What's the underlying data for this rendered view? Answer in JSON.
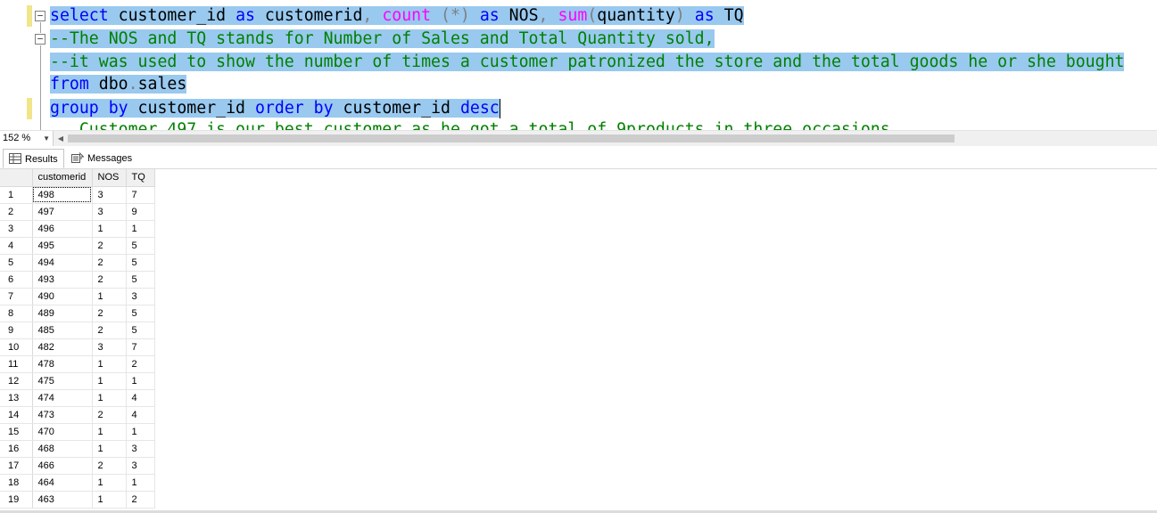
{
  "editor": {
    "lines": [
      {
        "tokens": [
          {
            "t": "select",
            "c": "kw"
          },
          {
            "t": " customer_id ",
            "c": ""
          },
          {
            "t": "as",
            "c": "kw"
          },
          {
            "t": " customerid",
            "c": ""
          },
          {
            "t": ", ",
            "c": "op"
          },
          {
            "t": "count",
            "c": "fn"
          },
          {
            "t": " (*) ",
            "c": "op"
          },
          {
            "t": "as",
            "c": "kw"
          },
          {
            "t": " NOS",
            "c": ""
          },
          {
            "t": ", ",
            "c": "op"
          },
          {
            "t": "sum",
            "c": "fn"
          },
          {
            "t": "(",
            "c": "op"
          },
          {
            "t": "quantity",
            "c": ""
          },
          {
            "t": ") ",
            "c": "op"
          },
          {
            "t": "as",
            "c": "kw"
          },
          {
            "t": " TQ",
            "c": ""
          }
        ]
      },
      {
        "tokens": [
          {
            "t": "--The NOS and TQ stands for Number of Sales and Total Quantity sold,",
            "c": "cm"
          }
        ]
      },
      {
        "tokens": [
          {
            "t": "--it was used to show the number of times a customer patronized the store and the total goods he or she bought",
            "c": "cm"
          }
        ]
      },
      {
        "tokens": [
          {
            "t": "from",
            "c": "kw"
          },
          {
            "t": " dbo",
            "c": ""
          },
          {
            "t": ".",
            "c": "op"
          },
          {
            "t": "sales",
            "c": ""
          }
        ]
      },
      {
        "tokens": [
          {
            "t": "group by",
            "c": "kw"
          },
          {
            "t": " customer_id ",
            "c": ""
          },
          {
            "t": "order by",
            "c": "kw"
          },
          {
            "t": " customer_id ",
            "c": ""
          },
          {
            "t": "desc",
            "c": "kw"
          }
        ]
      }
    ],
    "partial_line": "   Customer 497 is our best customer as he got a total of 9products in three occasions"
  },
  "zoom": {
    "value": "152 %"
  },
  "tabs": {
    "results": "Results",
    "messages": "Messages"
  },
  "grid": {
    "columns": [
      "customerid",
      "NOS",
      "TQ"
    ],
    "rows": [
      [
        "1",
        "498",
        "3",
        "7"
      ],
      [
        "2",
        "497",
        "3",
        "9"
      ],
      [
        "3",
        "496",
        "1",
        "1"
      ],
      [
        "4",
        "495",
        "2",
        "5"
      ],
      [
        "5",
        "494",
        "2",
        "5"
      ],
      [
        "6",
        "493",
        "2",
        "5"
      ],
      [
        "7",
        "490",
        "1",
        "3"
      ],
      [
        "8",
        "489",
        "2",
        "5"
      ],
      [
        "9",
        "485",
        "2",
        "5"
      ],
      [
        "10",
        "482",
        "3",
        "7"
      ],
      [
        "11",
        "478",
        "1",
        "2"
      ],
      [
        "12",
        "475",
        "1",
        "1"
      ],
      [
        "13",
        "474",
        "1",
        "4"
      ],
      [
        "14",
        "473",
        "2",
        "4"
      ],
      [
        "15",
        "470",
        "1",
        "1"
      ],
      [
        "16",
        "468",
        "1",
        "3"
      ],
      [
        "17",
        "466",
        "2",
        "3"
      ],
      [
        "18",
        "464",
        "1",
        "1"
      ],
      [
        "19",
        "463",
        "1",
        "2"
      ]
    ]
  },
  "icons": {
    "results_tab": "grid-icon",
    "messages_tab": "messages-icon",
    "zoom_dropdown": "chevron-down-icon",
    "scroll_left": "scroll-left-arrow-icon"
  }
}
